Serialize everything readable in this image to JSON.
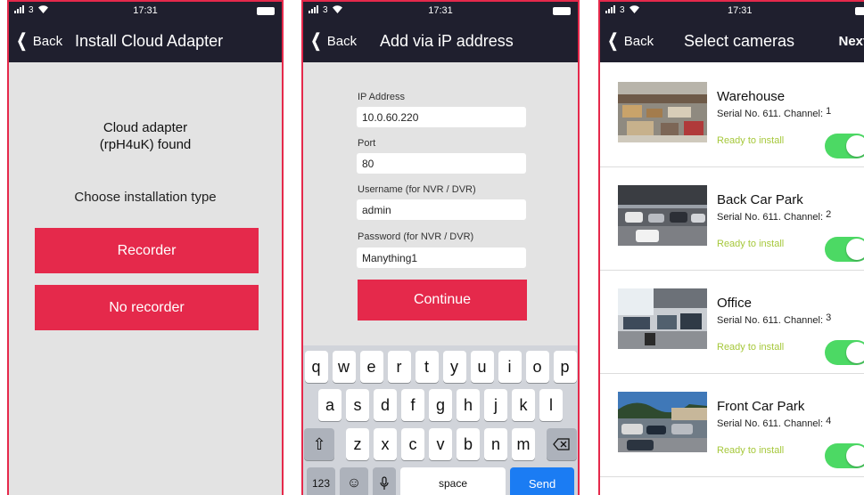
{
  "status_bar": {
    "carrier": "3",
    "time": "17:31"
  },
  "screen1": {
    "back_label": "Back",
    "title": "Install Cloud Adapter",
    "found_line1": "Cloud adapter",
    "found_line2": "(rpH4uK) found",
    "prompt": "Choose installation type",
    "recorder_label": "Recorder",
    "no_recorder_label": "No recorder"
  },
  "screen2": {
    "back_label": "Back",
    "title": "Add via iP address",
    "fields": [
      {
        "label": "IP Address",
        "value": "10.0.60.220"
      },
      {
        "label": "Port",
        "value": "80"
      },
      {
        "label": "Username (for NVR / DVR)",
        "value": "admin"
      },
      {
        "label": "Password (for NVR / DVR)",
        "value": "Manything1"
      }
    ],
    "continue_label": "Continue",
    "keyboard": {
      "row1": [
        "q",
        "w",
        "e",
        "r",
        "t",
        "y",
        "u",
        "i",
        "o",
        "p"
      ],
      "row2": [
        "a",
        "s",
        "d",
        "f",
        "g",
        "h",
        "j",
        "k",
        "l"
      ],
      "row3": [
        "z",
        "x",
        "c",
        "v",
        "b",
        "n",
        "m"
      ],
      "numbers_label": "123",
      "space_label": "space",
      "send_label": "Send"
    }
  },
  "screen3": {
    "back_label": "Back",
    "title": "Select cameras",
    "next_label": "Next",
    "cameras": [
      {
        "name": "Warehouse",
        "serial": "Serial No. 611. Channel:",
        "channel": "1",
        "status": "Ready to install",
        "enabled": true
      },
      {
        "name": "Back Car Park",
        "serial": "Serial No. 611. Channel:",
        "channel": "2",
        "status": "Ready to install",
        "enabled": true
      },
      {
        "name": "Office",
        "serial": "Serial No. 611. Channel:",
        "channel": "3",
        "status": "Ready to install",
        "enabled": true
      },
      {
        "name": "Front Car Park",
        "serial": "Serial No. 611. Channel:",
        "channel": "4",
        "status": "Ready to install",
        "enabled": true
      }
    ]
  },
  "colors": {
    "accent": "#e5294b",
    "navbar": "#1f1f2e",
    "ready_text": "#a6c83b",
    "toggle_on": "#4cd964",
    "send_key": "#1b7cf3"
  }
}
